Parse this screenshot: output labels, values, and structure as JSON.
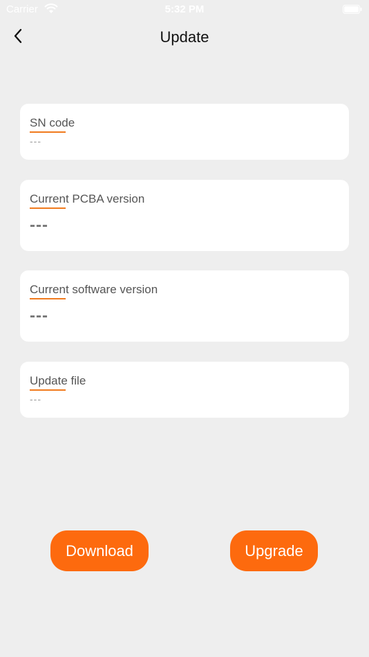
{
  "status_bar": {
    "carrier": "Carrier",
    "time": "5:32 PM"
  },
  "nav": {
    "title": "Update"
  },
  "cards": [
    {
      "label": "SN code",
      "value": "---"
    },
    {
      "label": "Current PCBA version",
      "value": "---"
    },
    {
      "label": "Current software version",
      "value": "---"
    },
    {
      "label": "Update file",
      "value": "---"
    }
  ],
  "actions": {
    "download_label": "Download",
    "upgrade_label": "Upgrade"
  },
  "colors": {
    "accent": "#fd6a0e",
    "underline": "#f07a1d",
    "background": "#eeeeee",
    "card": "#ffffff"
  }
}
